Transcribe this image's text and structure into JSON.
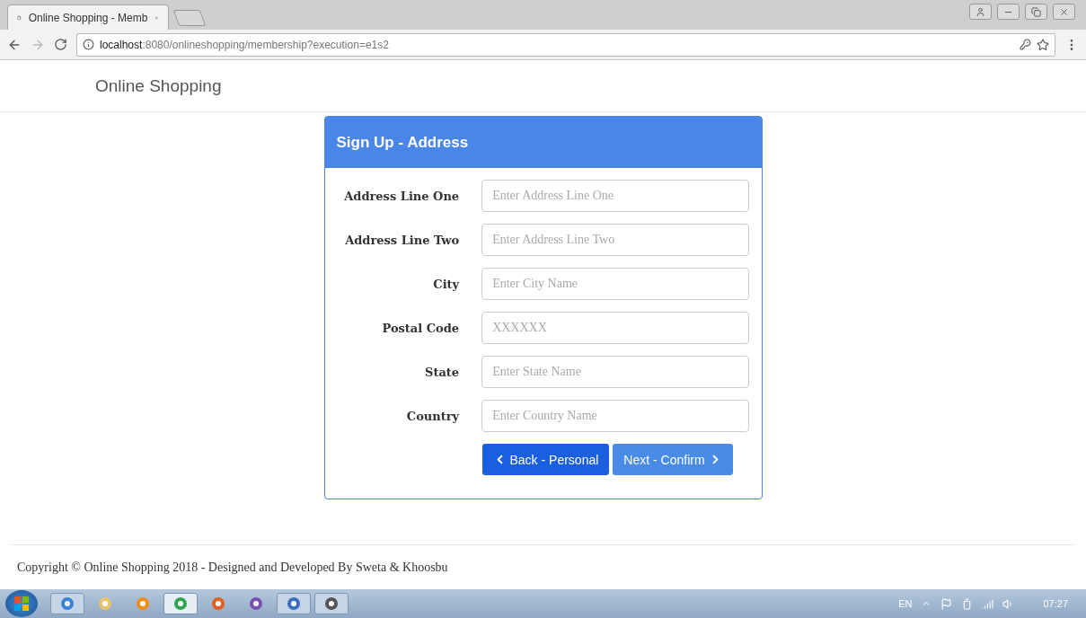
{
  "browser": {
    "tab_title": "Online Shopping - Memb",
    "url_host": "localhost",
    "url_rest": ":8080/onlineshopping/membership?execution=e1s2"
  },
  "navbar": {
    "brand": "Online Shopping"
  },
  "card": {
    "title": "Sign Up - Address",
    "fields": [
      {
        "label": "Address Line One",
        "placeholder": "Enter Address Line One"
      },
      {
        "label": "Address Line Two",
        "placeholder": "Enter Address Line Two"
      },
      {
        "label": "City",
        "placeholder": "Enter City Name"
      },
      {
        "label": "Postal Code",
        "placeholder": "XXXXXX"
      },
      {
        "label": "State",
        "placeholder": "Enter State Name"
      },
      {
        "label": "Country",
        "placeholder": "Enter Country Name"
      }
    ],
    "buttons": [
      {
        "label": "Back - Personal",
        "kind": "back"
      },
      {
        "label": "Next - Confirm",
        "kind": "next"
      }
    ]
  },
  "footer": {
    "text": "Copyright © Online Shopping 2018 - Designed and Developed By Sweta & Khoosbu"
  },
  "taskbar": {
    "apps": [
      {
        "open": true,
        "selected": false
      },
      {
        "open": false,
        "selected": false
      },
      {
        "open": false,
        "selected": false
      },
      {
        "open": true,
        "selected": true
      },
      {
        "open": false,
        "selected": false
      },
      {
        "open": false,
        "selected": false
      },
      {
        "open": true,
        "selected": false
      },
      {
        "open": true,
        "selected": false
      }
    ],
    "language": "EN",
    "clock": "07:27"
  }
}
